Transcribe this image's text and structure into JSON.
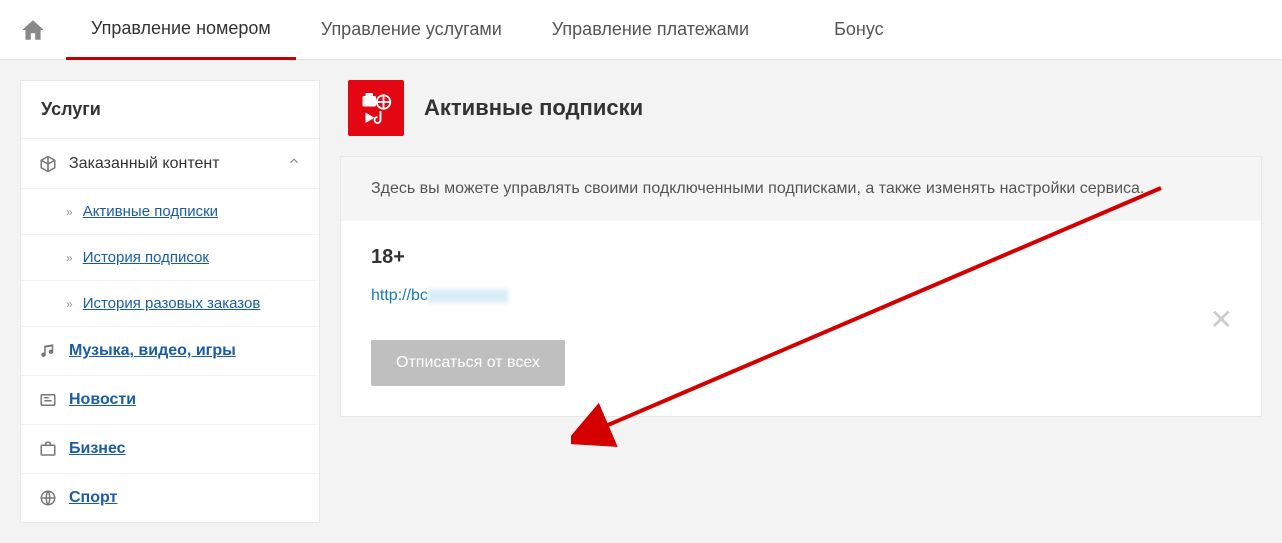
{
  "tabs": {
    "t0": "Управление номером",
    "t1": "Управление услугами",
    "t2": "Управление платежами",
    "t3": "Бонус"
  },
  "sidebar": {
    "title": "Услуги",
    "section": "Заказанный контент",
    "sub0": "Активные подписки",
    "sub1": "История подписок",
    "sub2": "История разовых заказов",
    "m0": "Музыка, видео, игры",
    "m1": "Новости",
    "m2": "Бизнес",
    "m3": "Спорт"
  },
  "page": {
    "title": "Активные подписки",
    "intro": "Здесь вы можете управлять своими подключенными подписками, а также изменять настройки сервиса.",
    "tag": "18+",
    "url_prefix": "http://bс",
    "unsubscribe": "Отписаться от всех"
  }
}
